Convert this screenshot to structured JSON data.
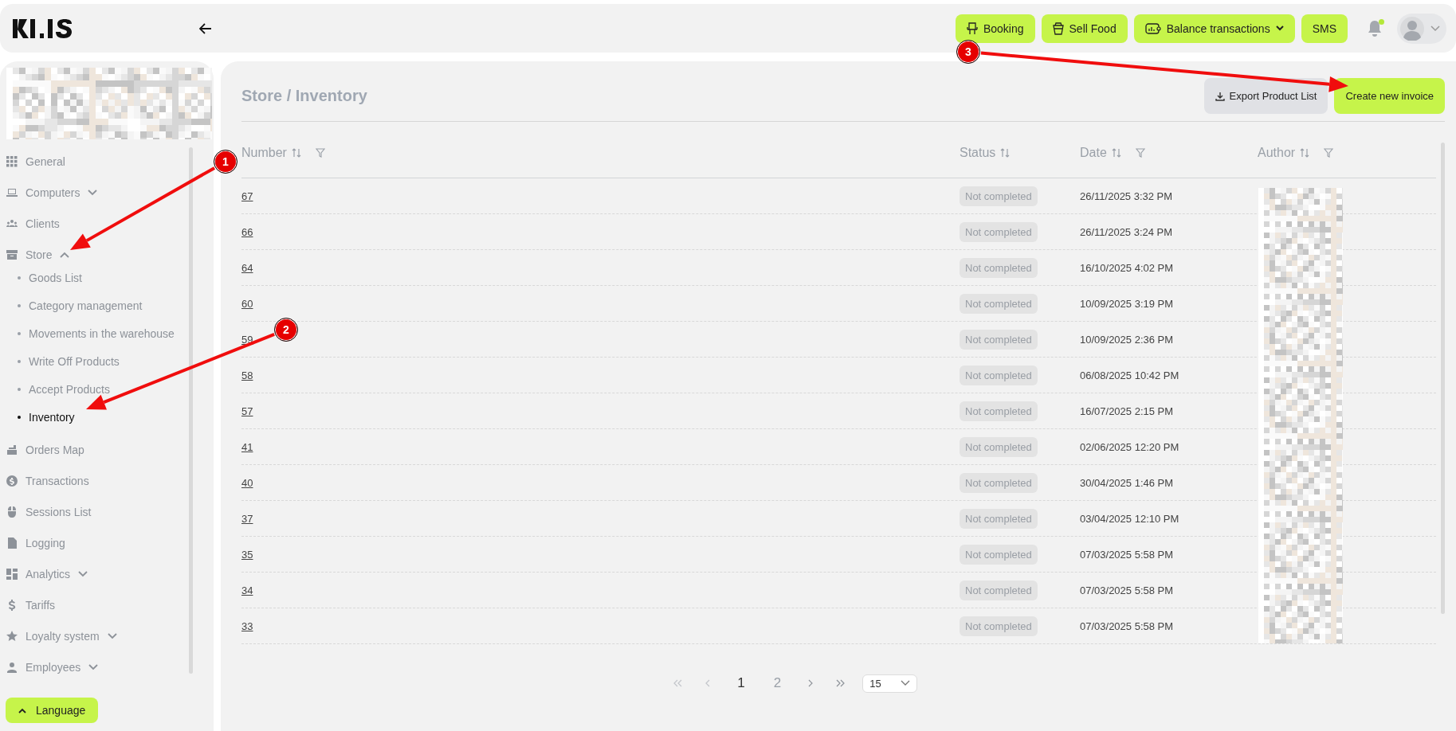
{
  "header": {
    "buttons": [
      {
        "label": "Booking",
        "kind": "booking",
        "dropdown": false
      },
      {
        "label": "Sell Food",
        "kind": "food",
        "dropdown": false
      },
      {
        "label": "Balance transactions",
        "kind": "balance",
        "dropdown": true
      },
      {
        "label": "SMS",
        "kind": "plain",
        "dropdown": false
      }
    ],
    "notifications": {
      "unread": true
    }
  },
  "sidebar": {
    "items": [
      {
        "label": "General"
      },
      {
        "label": "Computers",
        "expanded": false
      },
      {
        "label": "Clients"
      },
      {
        "label": "Store",
        "expanded": true,
        "children": [
          {
            "label": "Goods List",
            "selected": false
          },
          {
            "label": "Category management",
            "selected": false
          },
          {
            "label": "Movements in the warehouse",
            "selected": false
          },
          {
            "label": "Write Off Products",
            "selected": false
          },
          {
            "label": "Accept Products",
            "selected": false
          },
          {
            "label": "Inventory",
            "selected": true
          }
        ]
      },
      {
        "label": "Orders Map"
      },
      {
        "label": "Transactions"
      },
      {
        "label": "Sessions List"
      },
      {
        "label": "Logging"
      },
      {
        "label": "Analytics",
        "expanded": false
      },
      {
        "label": "Tariffs"
      },
      {
        "label": "Loyalty system",
        "expanded": false
      },
      {
        "label": "Employees",
        "expanded": false
      }
    ],
    "language_button": "Language"
  },
  "main": {
    "breadcrumb": "Store / Inventory",
    "actions": [
      {
        "label": "Export Product List",
        "kind": "secondary"
      },
      {
        "label": "Create new invoice",
        "kind": "primary"
      }
    ],
    "table": {
      "columns": [
        {
          "label": "Number",
          "filterable": true
        },
        {
          "label": "Status",
          "filterable": false
        },
        {
          "label": "Date",
          "filterable": true
        },
        {
          "label": "Author",
          "filterable": true
        }
      ],
      "rows": [
        {
          "number": "67",
          "status": "Not completed",
          "date": "26/11/2025 3:32 PM"
        },
        {
          "number": "66",
          "status": "Not completed",
          "date": "26/11/2025 3:24 PM"
        },
        {
          "number": "64",
          "status": "Not completed",
          "date": "16/10/2025 4:02 PM"
        },
        {
          "number": "60",
          "status": "Not completed",
          "date": "10/09/2025 3:19 PM"
        },
        {
          "number": "59",
          "status": "Not completed",
          "date": "10/09/2025 2:36 PM"
        },
        {
          "number": "58",
          "status": "Not completed",
          "date": "06/08/2025 10:42 PM"
        },
        {
          "number": "57",
          "status": "Not completed",
          "date": "16/07/2025 2:15 PM"
        },
        {
          "number": "41",
          "status": "Not completed",
          "date": "02/06/2025 12:20 PM"
        },
        {
          "number": "40",
          "status": "Not completed",
          "date": "30/04/2025 1:46 PM"
        },
        {
          "number": "37",
          "status": "Not completed",
          "date": "03/04/2025 12:10 PM"
        },
        {
          "number": "35",
          "status": "Not completed",
          "date": "07/03/2025 5:58 PM"
        },
        {
          "number": "34",
          "status": "Not completed",
          "date": "07/03/2025 5:58 PM"
        },
        {
          "number": "33",
          "status": "Not completed",
          "date": "07/03/2025 5:58 PM"
        }
      ]
    },
    "pagination": {
      "pages": [
        {
          "label": "1",
          "selected": true
        },
        {
          "label": "2",
          "selected": false
        }
      ],
      "page_size": "15"
    }
  },
  "annotations": [
    {
      "label": "1"
    },
    {
      "label": "2"
    },
    {
      "label": "3"
    }
  ]
}
